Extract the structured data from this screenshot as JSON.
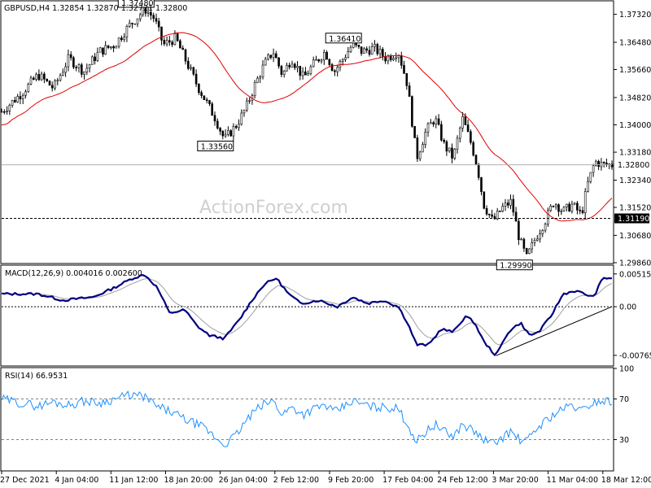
{
  "chart_data": {
    "type": "candlestick",
    "symbol_header": "GBPUSD,H4  1.32854 1.32870 1.32721 1.32800",
    "watermark": "ActionForex.com",
    "x_labels": [
      "27 Dec 2021",
      "4 Jan 04:00",
      "11 Jan 12:00",
      "18 Jan 20:00",
      "26 Jan 04:00",
      "2 Feb 12:00",
      "9 Feb 20:00",
      "17 Feb 04:00",
      "24 Feb 12:00",
      "3 Mar 20:00",
      "11 Mar 04:00",
      "18 Mar 12:00"
    ],
    "price": {
      "ylim": [
        1.2986,
        1.377
      ],
      "ticks": [
        "1.37320",
        "1.36480",
        "1.35660",
        "1.34820",
        "1.34000",
        "1.33180",
        "1.32340",
        "1.31520",
        "1.30680",
        "1.29860"
      ],
      "tick_values": [
        1.3732,
        1.3648,
        1.3566,
        1.3482,
        1.34,
        1.3318,
        1.3234,
        1.3152,
        1.3068,
        1.2986
      ],
      "current_price_label": "1.32800",
      "current_price": 1.328,
      "support_label": "1.31190",
      "support": 1.3119,
      "annotations": [
        {
          "text": "1.37480",
          "value": 1.3748,
          "x_frac": 0.235
        },
        {
          "text": "1.33560",
          "value": 1.3356,
          "x_frac": 0.365
        },
        {
          "text": "1.36410",
          "value": 1.3641,
          "x_frac": 0.575
        },
        {
          "text": "1.29990",
          "value": 1.2999,
          "x_frac": 0.855
        }
      ],
      "keypoints": [
        [
          0.0,
          1.344
        ],
        [
          0.03,
          1.349
        ],
        [
          0.06,
          1.355
        ],
        [
          0.085,
          1.351
        ],
        [
          0.11,
          1.36
        ],
        [
          0.135,
          1.356
        ],
        [
          0.16,
          1.362
        ],
        [
          0.185,
          1.364
        ],
        [
          0.21,
          1.37
        ],
        [
          0.235,
          1.3748
        ],
        [
          0.25,
          1.372
        ],
        [
          0.265,
          1.364
        ],
        [
          0.285,
          1.366
        ],
        [
          0.3,
          1.36
        ],
        [
          0.32,
          1.352
        ],
        [
          0.335,
          1.347
        ],
        [
          0.35,
          1.342
        ],
        [
          0.365,
          1.3356
        ],
        [
          0.385,
          1.34
        ],
        [
          0.4,
          1.345
        ],
        [
          0.415,
          1.352
        ],
        [
          0.43,
          1.358
        ],
        [
          0.445,
          1.362
        ],
        [
          0.46,
          1.355
        ],
        [
          0.475,
          1.36
        ],
        [
          0.495,
          1.354
        ],
        [
          0.51,
          1.358
        ],
        [
          0.53,
          1.362
        ],
        [
          0.545,
          1.356
        ],
        [
          0.56,
          1.36
        ],
        [
          0.575,
          1.3641
        ],
        [
          0.59,
          1.362
        ],
        [
          0.61,
          1.363
        ],
        [
          0.63,
          1.36
        ],
        [
          0.65,
          1.362
        ],
        [
          0.665,
          1.352
        ],
        [
          0.68,
          1.33
        ],
        [
          0.695,
          1.338
        ],
        [
          0.71,
          1.342
        ],
        [
          0.725,
          1.334
        ],
        [
          0.74,
          1.33
        ],
        [
          0.755,
          1.342
        ],
        [
          0.77,
          1.334
        ],
        [
          0.78,
          1.327
        ],
        [
          0.79,
          1.316
        ],
        [
          0.805,
          1.311
        ],
        [
          0.82,
          1.315
        ],
        [
          0.835,
          1.317
        ],
        [
          0.848,
          1.306
        ],
        [
          0.86,
          1.3
        ],
        [
          0.875,
          1.306
        ],
        [
          0.89,
          1.311
        ],
        [
          0.905,
          1.317
        ],
        [
          0.92,
          1.314
        ],
        [
          0.935,
          1.316
        ],
        [
          0.95,
          1.313
        ],
        [
          0.96,
          1.322
        ],
        [
          0.972,
          1.329
        ],
        [
          0.985,
          1.328
        ]
      ]
    },
    "macd": {
      "label": "MACD(12,26,9) 0.004016 0.002600",
      "ylim": [
        -0.0092,
        0.0064
      ],
      "ticks": [
        "0.005152",
        "0.00",
        "-0.00765"
      ],
      "tick_values": [
        0.005152,
        0.0,
        -0.00765
      ],
      "current_label": "0.00",
      "keypoints": [
        [
          0.0,
          0.002
        ],
        [
          0.06,
          0.002
        ],
        [
          0.1,
          0.001
        ],
        [
          0.15,
          0.0015
        ],
        [
          0.185,
          0.003
        ],
        [
          0.215,
          0.0045
        ],
        [
          0.235,
          0.005
        ],
        [
          0.255,
          0.003
        ],
        [
          0.275,
          -0.001
        ],
        [
          0.3,
          -0.0005
        ],
        [
          0.32,
          -0.003
        ],
        [
          0.34,
          -0.0045
        ],
        [
          0.365,
          -0.005
        ],
        [
          0.39,
          -0.002
        ],
        [
          0.41,
          0.001
        ],
        [
          0.43,
          0.0035
        ],
        [
          0.45,
          0.0045
        ],
        [
          0.47,
          0.002
        ],
        [
          0.49,
          0.0005
        ],
        [
          0.52,
          0.001
        ],
        [
          0.55,
          0.0
        ],
        [
          0.575,
          0.0015
        ],
        [
          0.6,
          0.0005
        ],
        [
          0.625,
          0.001
        ],
        [
          0.65,
          0.0
        ],
        [
          0.665,
          -0.0025
        ],
        [
          0.68,
          -0.006
        ],
        [
          0.7,
          -0.006
        ],
        [
          0.72,
          -0.0035
        ],
        [
          0.74,
          -0.004
        ],
        [
          0.76,
          -0.0015
        ],
        [
          0.775,
          -0.0025
        ],
        [
          0.79,
          -0.0055
        ],
        [
          0.81,
          -0.0077
        ],
        [
          0.83,
          -0.004
        ],
        [
          0.85,
          -0.0025
        ],
        [
          0.865,
          -0.0045
        ],
        [
          0.88,
          -0.004
        ],
        [
          0.9,
          -0.0015
        ],
        [
          0.92,
          0.002
        ],
        [
          0.94,
          0.0025
        ],
        [
          0.955,
          0.002
        ],
        [
          0.97,
          0.0015
        ],
        [
          0.985,
          0.0045
        ]
      ],
      "trendline": [
        [
          0.81,
          -0.0077
        ],
        [
          1.0,
          0.0
        ]
      ]
    },
    "rsi": {
      "label": "RSI(14) 66.9531",
      "ylim": [
        0,
        100
      ],
      "ticks": [
        "100",
        "70",
        "30",
        "0"
      ],
      "tick_values": [
        100,
        70,
        30,
        0
      ],
      "levels": [
        70,
        30
      ],
      "keypoints": [
        [
          0.0,
          70
        ],
        [
          0.03,
          66
        ],
        [
          0.06,
          63
        ],
        [
          0.085,
          67
        ],
        [
          0.11,
          64
        ],
        [
          0.135,
          68
        ],
        [
          0.16,
          66
        ],
        [
          0.185,
          70
        ],
        [
          0.21,
          74
        ],
        [
          0.235,
          72
        ],
        [
          0.255,
          62
        ],
        [
          0.275,
          58
        ],
        [
          0.3,
          50
        ],
        [
          0.32,
          45
        ],
        [
          0.335,
          40
        ],
        [
          0.35,
          32
        ],
        [
          0.365,
          25
        ],
        [
          0.385,
          35
        ],
        [
          0.4,
          48
        ],
        [
          0.415,
          58
        ],
        [
          0.43,
          65
        ],
        [
          0.445,
          68
        ],
        [
          0.46,
          55
        ],
        [
          0.475,
          62
        ],
        [
          0.495,
          55
        ],
        [
          0.51,
          60
        ],
        [
          0.53,
          64
        ],
        [
          0.545,
          57
        ],
        [
          0.56,
          62
        ],
        [
          0.575,
          68
        ],
        [
          0.59,
          65
        ],
        [
          0.61,
          62
        ],
        [
          0.63,
          62
        ],
        [
          0.65,
          60
        ],
        [
          0.665,
          45
        ],
        [
          0.68,
          28
        ],
        [
          0.695,
          38
        ],
        [
          0.71,
          45
        ],
        [
          0.725,
          38
        ],
        [
          0.74,
          33
        ],
        [
          0.755,
          45
        ],
        [
          0.77,
          40
        ],
        [
          0.78,
          35
        ],
        [
          0.79,
          30
        ],
        [
          0.805,
          26
        ],
        [
          0.82,
          32
        ],
        [
          0.835,
          38
        ],
        [
          0.848,
          30
        ],
        [
          0.86,
          28
        ],
        [
          0.875,
          40
        ],
        [
          0.89,
          48
        ],
        [
          0.905,
          55
        ],
        [
          0.92,
          60
        ],
        [
          0.935,
          64
        ],
        [
          0.95,
          58
        ],
        [
          0.96,
          63
        ],
        [
          0.972,
          67
        ],
        [
          0.985,
          68
        ]
      ]
    }
  }
}
